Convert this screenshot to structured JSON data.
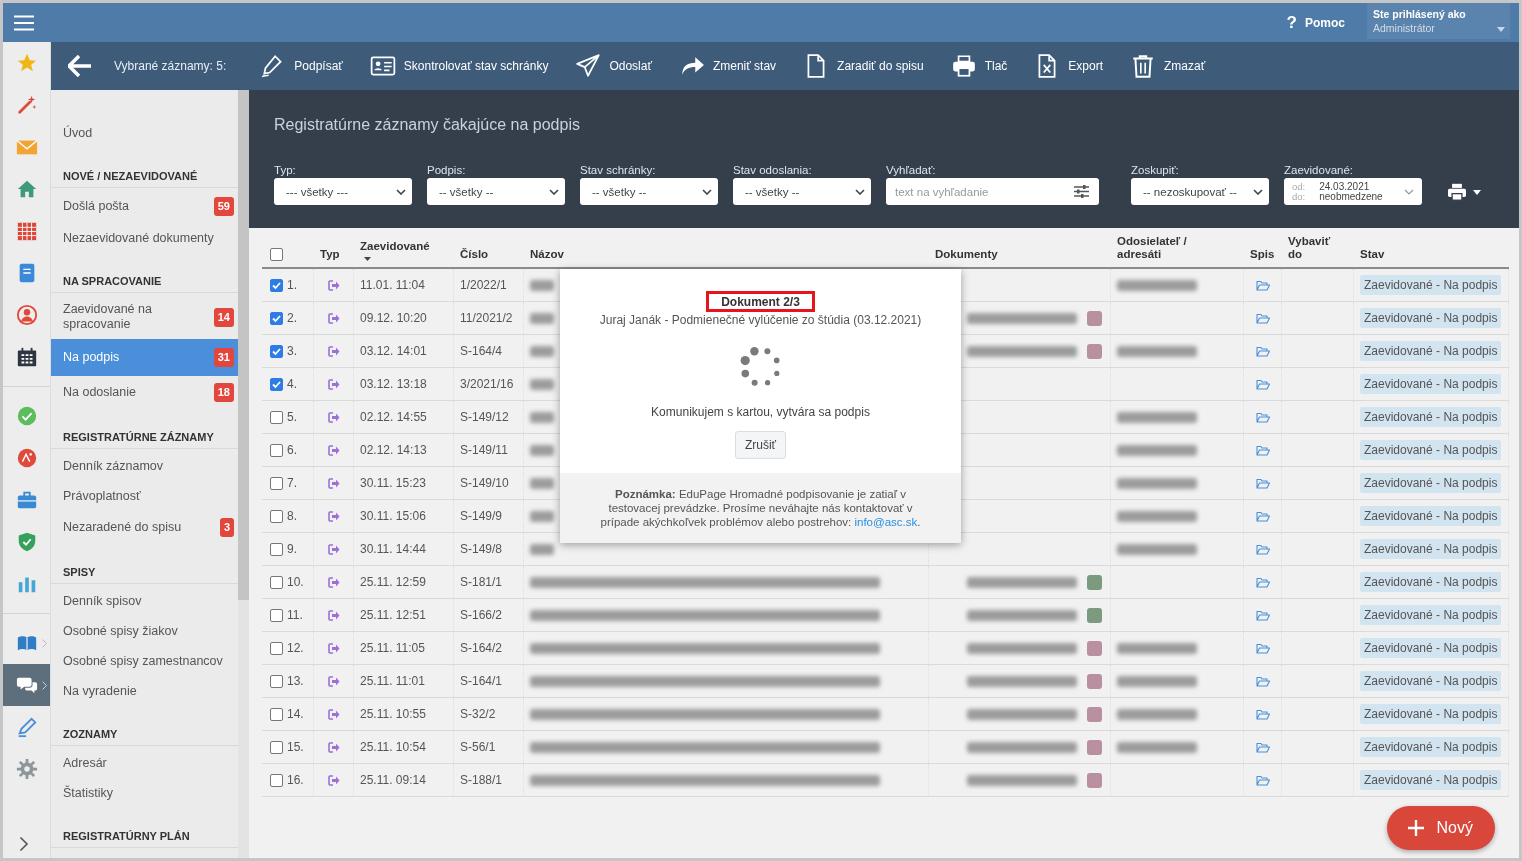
{
  "top_bar": {
    "help": {
      "icon": "?",
      "label": "Pomoc"
    },
    "user": {
      "caption": "Ste prihlásený ako",
      "name": "Administrátor"
    }
  },
  "rail": {
    "groups": [
      {
        "items": [
          {
            "kind": "star",
            "selected": false
          },
          {
            "kind": "wand",
            "selected": false
          },
          {
            "kind": "envelope",
            "selected": false
          },
          {
            "kind": "house",
            "selected": false
          },
          {
            "kind": "grid",
            "selected": false
          },
          {
            "kind": "notebook",
            "selected": false
          },
          {
            "kind": "person",
            "selected": false
          },
          {
            "kind": "calendar",
            "selected": false
          }
        ]
      },
      {
        "items": [
          {
            "kind": "check",
            "selected": false
          },
          {
            "kind": "badge",
            "selected": false
          },
          {
            "kind": "briefcase",
            "selected": false
          },
          {
            "kind": "shield",
            "selected": false
          },
          {
            "kind": "chart",
            "selected": false
          }
        ]
      },
      {
        "items": [
          {
            "kind": "book",
            "selected": false,
            "has_submenu": true
          },
          {
            "kind": "chat",
            "selected": true,
            "has_submenu": true
          },
          {
            "kind": "pen",
            "selected": false
          },
          {
            "kind": "gear",
            "selected": false
          }
        ]
      }
    ]
  },
  "toolbar": {
    "selection_label": "Vybrané záznamy: 5:",
    "actions": [
      {
        "kind": "sign",
        "label": "Podpísať"
      },
      {
        "kind": "check_mailbox",
        "label": "Skontrolovať stav schránky"
      },
      {
        "kind": "send",
        "label": "Odoslať"
      },
      {
        "kind": "change_status",
        "label": "Zmeniť stav"
      },
      {
        "kind": "add_to_file",
        "label": "Zaradiť do spisu"
      },
      {
        "kind": "print",
        "label": "Tlač"
      },
      {
        "kind": "export",
        "label": "Export"
      },
      {
        "kind": "delete",
        "label": "Zmazať"
      }
    ]
  },
  "sidebar": {
    "sections": [
      {
        "items": [
          {
            "label": "Úvod",
            "selected": false
          }
        ]
      },
      {
        "heading": "NOVÉ / NEZAEVIDOVANÉ",
        "items": [
          {
            "label": "Došlá pošta",
            "badge": "59",
            "selected": false
          },
          {
            "label": "Nezaevidované dokumenty",
            "selected": false
          }
        ]
      },
      {
        "heading": "NA SPRACOVANIE",
        "items": [
          {
            "label": "Zaevidované na spracovanie",
            "badge": "14",
            "selected": false
          },
          {
            "label": "Na podpis",
            "badge": "31",
            "selected": true
          },
          {
            "label": "Na odoslanie",
            "badge": "18",
            "selected": false
          }
        ]
      },
      {
        "heading": "REGISTRATÚRNE ZÁZNAMY",
        "items": [
          {
            "label": "Denník záznamov",
            "selected": false
          },
          {
            "label": "Právoplatnosť",
            "selected": false
          },
          {
            "label": "Nezaradené do spisu",
            "badge": "3",
            "selected": false
          }
        ]
      },
      {
        "heading": "SPISY",
        "items": [
          {
            "label": "Denník spisov",
            "selected": false
          },
          {
            "label": "Osobné spisy žiakov",
            "selected": false
          },
          {
            "label": "Osobné spisy zamestnancov",
            "selected": false
          },
          {
            "label": "Na vyradenie",
            "selected": false
          }
        ]
      },
      {
        "heading": "ZOZNAMY",
        "items": [
          {
            "label": "Adresár",
            "selected": false
          },
          {
            "label": "Štatistiky",
            "selected": false
          }
        ]
      },
      {
        "heading": "REGISTRATÚRNY PLÁN"
      }
    ]
  },
  "page": {
    "subtitle": "Registratúrne záznamy čakajúce na podpis"
  },
  "filters": [
    {
      "kind": "select",
      "label": "Typ:",
      "value": "--- všetky ---"
    },
    {
      "kind": "select",
      "label": "Podpis:",
      "value": "-- všetky --"
    },
    {
      "kind": "select",
      "label": "Stav schránky:",
      "value": "-- všetky --"
    },
    {
      "kind": "select",
      "label": "Stav odoslania:",
      "value": "-- všetky --"
    },
    {
      "kind": "search",
      "label": "Vyhľadať:",
      "placeholder": "text na vyhľadanie"
    },
    {
      "kind": "select",
      "label": "Zoskupiť:",
      "value": "-- nezoskupovať --"
    },
    {
      "kind": "date_range",
      "label": "Zaevidované:",
      "from_label": "od:",
      "from": "24.03.2021",
      "to_label": "do:",
      "to": "neobmedzene"
    }
  ],
  "table": {
    "all_checked": false,
    "columns": [
      {
        "label": "Typ"
      },
      {
        "label": "Zaevidované",
        "sorted": true
      },
      {
        "label": "Číslo"
      },
      {
        "label": "Názov"
      },
      {
        "label": "Dokumenty"
      },
      {
        "label": "Odosielateľ / adresáti"
      },
      {
        "label": "Spis"
      },
      {
        "label": "Vybaviť do"
      },
      {
        "label": "Stav"
      }
    ],
    "rows": [
      {
        "kind": "covered",
        "number": "1.",
        "checked": true,
        "registered": "11.01. 11:04",
        "reference": "1/2022/1",
        "documents_redacted": false,
        "sender_redacted": true,
        "status": "Zaevidované - Na podpis"
      },
      {
        "kind": "covered",
        "number": "2.",
        "checked": true,
        "registered": "09.12. 10:20",
        "reference": "11/2021/2",
        "documents_redacted": true,
        "document_tag": {
          "color": "#b8909f"
        },
        "sender_redacted": false,
        "status": "Zaevidované - Na podpis"
      },
      {
        "kind": "covered",
        "number": "3.",
        "checked": true,
        "registered": "03.12. 14:01",
        "reference": "S-164/4",
        "documents_redacted": true,
        "document_tag": {
          "color": "#b8909f"
        },
        "sender_redacted": true,
        "status": "Zaevidované - Na podpis"
      },
      {
        "kind": "covered",
        "number": "4.",
        "checked": true,
        "registered": "03.12. 13:18",
        "reference": "3/2021/16",
        "documents_redacted": false,
        "sender_redacted": false,
        "status": "Zaevidované - Na podpis"
      },
      {
        "kind": "covered",
        "number": "5.",
        "checked": false,
        "registered": "02.12. 14:55",
        "reference": "S-149/12",
        "documents_redacted": false,
        "sender_redacted": true,
        "status": "Zaevidované - Na podpis"
      },
      {
        "kind": "covered",
        "number": "6.",
        "checked": false,
        "registered": "02.12. 14:13",
        "reference": "S-149/11",
        "documents_redacted": false,
        "sender_redacted": true,
        "status": "Zaevidované - Na podpis"
      },
      {
        "kind": "covered",
        "number": "7.",
        "checked": false,
        "registered": "30.11. 15:23",
        "reference": "S-149/10",
        "documents_redacted": false,
        "sender_redacted": true,
        "status": "Zaevidované - Na podpis"
      },
      {
        "kind": "covered",
        "number": "8.",
        "checked": false,
        "registered": "30.11. 15:06",
        "reference": "S-149/9",
        "documents_redacted": false,
        "sender_redacted": true,
        "status": "Zaevidované - Na podpis"
      },
      {
        "kind": "covered",
        "number": "9.",
        "checked": false,
        "registered": "30.11. 14:44",
        "reference": "S-149/8",
        "documents_redacted": false,
        "sender_redacted": true,
        "status": "Zaevidované - Na podpis"
      },
      {
        "kind": "open",
        "number": "10.",
        "checked": false,
        "registered": "25.11. 12:59",
        "reference": "S-181/1",
        "documents_redacted": true,
        "document_tag": {
          "color": "#7c9a7e"
        },
        "sender_redacted": false,
        "status": "Zaevidované - Na podpis"
      },
      {
        "kind": "open",
        "number": "11.",
        "checked": false,
        "registered": "25.11. 12:51",
        "reference": "S-166/2",
        "documents_redacted": true,
        "document_tag": {
          "color": "#7c9a7e"
        },
        "sender_redacted": false,
        "status": "Zaevidované - Na podpis"
      },
      {
        "kind": "open",
        "number": "12.",
        "checked": false,
        "registered": "25.11. 11:05",
        "reference": "S-164/2",
        "documents_redacted": true,
        "document_tag": {
          "color": "#b8909f"
        },
        "sender_redacted": true,
        "status": "Zaevidované - Na podpis"
      },
      {
        "kind": "open",
        "number": "13.",
        "checked": false,
        "registered": "25.11. 11:01",
        "reference": "S-164/1",
        "documents_redacted": true,
        "document_tag": {
          "color": "#b8909f"
        },
        "sender_redacted": true,
        "status": "Zaevidované - Na podpis"
      },
      {
        "kind": "open",
        "number": "14.",
        "checked": false,
        "registered": "25.11. 10:55",
        "reference": "S-32/2",
        "documents_redacted": true,
        "document_tag": {
          "color": "#b8909f"
        },
        "sender_redacted": true,
        "status": "Zaevidované - Na podpis"
      },
      {
        "kind": "open",
        "number": "15.",
        "checked": false,
        "registered": "25.11. 10:54",
        "reference": "S-56/1",
        "documents_redacted": true,
        "document_tag": {
          "color": "#b8909f"
        },
        "sender_redacted": true,
        "status": "Zaevidované - Na podpis"
      },
      {
        "kind": "open",
        "number": "16.",
        "checked": false,
        "registered": "25.11. 09:14",
        "reference": "S-188/1",
        "documents_redacted": true,
        "document_tag": {
          "color": "#b8909f"
        },
        "sender_redacted": false,
        "status": "Zaevidované - Na podpis"
      }
    ]
  },
  "dialog": {
    "title": "Dokument 2/3",
    "subtitle": "Juraj Janák - Podmienečné vylúčenie zo štúdia (03.12.2021)",
    "message": "Komunikujem s kartou, vytvára sa podpis",
    "cancel": "Zrušiť",
    "note": "**Poznámka:** EduPage Hromadné podpisovanie je zatiaľ v testovacej prevádzke. Prosíme neváhajte nás kontaktovať v prípade akýchkoľvek problémov alebo postrehov: ",
    "link": "info@asc.sk",
    "note_end": "."
  },
  "fab": {
    "label": "Nový"
  }
}
